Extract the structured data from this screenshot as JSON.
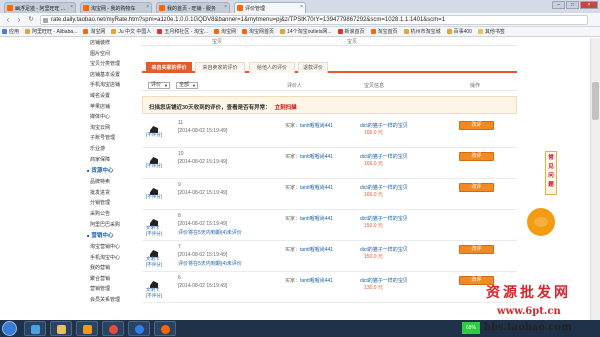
{
  "browser": {
    "tabs": [
      {
        "label": "幽浮足迹 - 阿里旺旺 ..."
      },
      {
        "label": "淘宝网 - 我的购物车"
      },
      {
        "label": "我的首页 - 旺铺 - 服务"
      },
      {
        "label": "评价管理"
      }
    ],
    "window_controls": [
      "–",
      "□",
      "×"
    ],
    "url": "rate.daily.taobao.net/myRate.htm?spm=a1z0e.1.0.0.1GQDV8&banner=1&mytmenu=pj&z/TPStK70rY=1394779867292&scm=1028.1.1.1401&scm=1",
    "bookmarks": [
      "应用",
      "阿里旺旺 - Alibaba...",
      "淘宝网",
      "Ju 中文 中国人",
      "五月和社区 - 淘宝...",
      "淘宝网",
      "淘宝网首页",
      "14个淘宝outlets网...",
      "新浪首页",
      "淘宝首页",
      "杭州市淘宝城",
      "百事400",
      "其他书签"
    ]
  },
  "sidebar": {
    "items_top": [
      "店铺装修",
      "图片空间",
      "宝贝分类管理",
      "店铺基本设置",
      "手机淘宝店铺",
      "域名设置",
      "苹果店铺",
      "媒体中心",
      "淘宝云网",
      "子账号管理",
      "乐业游",
      "商家保障"
    ],
    "section1": {
      "title": "货源中心",
      "items": [
        "品牌特卖",
        "批发进货",
        "分销管理",
        "采购公告",
        "阿里巴巴采购"
      ]
    },
    "section2": {
      "title": "营销中心",
      "items": [
        "淘宝营销中心",
        "手机淘宝中心",
        "我的营销",
        "聚合营销",
        "营销管理",
        "会员关系管理"
      ]
    }
  },
  "top_strip": {
    "left": "宝贝",
    "right": "宝贝"
  },
  "rate_tabs": [
    "来自买家的评价",
    "来自卖家的评价",
    "给他人的评价",
    "退款评价"
  ],
  "filters": {
    "select1": "评价",
    "select2": "全部",
    "col_rater": "评价人",
    "col_item": "宝贝信息",
    "col_action": "操作"
  },
  "notice": {
    "text": "扫描您店铺近30天收到的评价，查看是否有异常：",
    "link": "立刻扫描"
  },
  "rows": [
    {
      "count": "11",
      "date": "[2014-08-02 15:19:49]",
      "label1": "[不评分]",
      "label2": "",
      "note": "",
      "buyer_prefix": "买家：",
      "buyer": "tantt喔喔尚441",
      "product": "dict的猫子一样的宝贝",
      "price": "166.0 元",
      "button": "改评"
    },
    {
      "count": "10",
      "date": "[2014-08-02 15:19:49]",
      "label1": "[不评分]",
      "label2": "",
      "note": "",
      "buyer_prefix": "买家：",
      "buyer": "tantt喔喔尚441",
      "product": "dict的猫子一样的宝贝",
      "price": "166.0 元",
      "button": "改评"
    },
    {
      "count": "9",
      "date": "[2014-08-02 15:19:49]",
      "label1": "[不评分]",
      "label2": "",
      "note": "",
      "buyer_prefix": "买家：",
      "buyer": "tantt喔喔尚441",
      "product": "dict的猫子一样的宝贝",
      "price": "166.0 元",
      "button": "改评"
    },
    {
      "count": "8",
      "date": "[2014-08-02 15:19:49]",
      "label1": "文明卡",
      "label2": "[不评分]",
      "note": "评价将在5天内到期(4)未评价",
      "buyer_prefix": "买家：",
      "buyer": "tantt喔喔尚441",
      "product": "dict的猫子一样的宝贝",
      "price": "150.0 元",
      "button": ""
    },
    {
      "count": "7",
      "date": "[2014-08-02 15:19:49]",
      "label1": "文明卡",
      "label2": "[不评分]",
      "note": "评价将在5天内到期(4)未评价",
      "buyer_prefix": "买家：",
      "buyer": "tantt喔喔尚441",
      "product": "dict的猫子一样的宝贝",
      "price": "150.0 元",
      "button": "改评"
    },
    {
      "count": "6",
      "date": "[2014-08-02 15:19:49]",
      "label1": "文明卡",
      "label2": "[不评分]",
      "note": "",
      "buyer_prefix": "买家：",
      "buyer": "tantt喔喔尚441",
      "product": "dict的猫子一样的宝贝",
      "price": "130.0 元",
      "button": "改评"
    }
  ],
  "float_faq": "常见问题",
  "watermark": {
    "cn": "资源批发网",
    "url": "www.6pt.cn",
    "tb": "bbs.taobao.com"
  },
  "taskbar": {
    "apps": [
      "explorer",
      "folder",
      "media",
      "chrome",
      "ie",
      "wangwang"
    ],
    "tray_badge": "68%"
  },
  "colors": {
    "accent": "#e55a2b",
    "button": "#f08a24",
    "link": "#1a5ea8",
    "notice_bg": "#fdf5e6",
    "taskbar": "#20324a"
  }
}
